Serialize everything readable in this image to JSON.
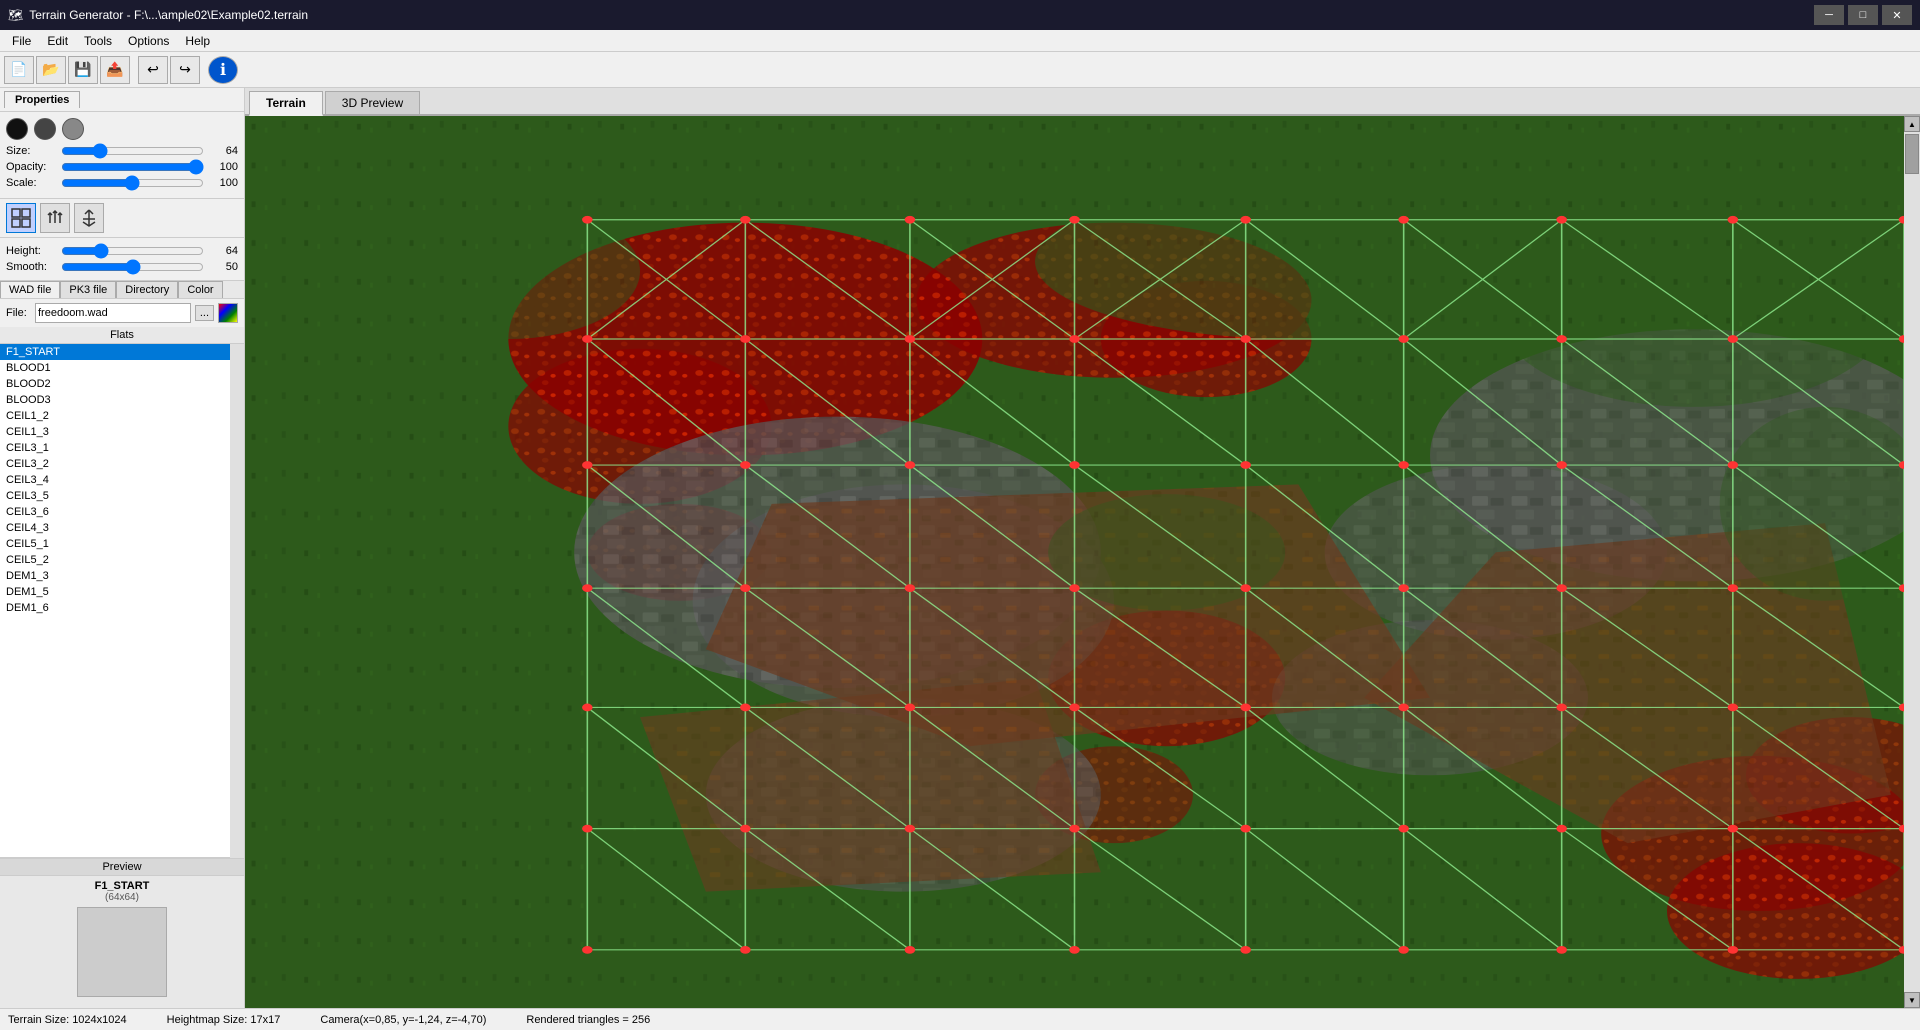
{
  "window": {
    "title": "Terrain Generator - F:\\...\\ample02\\Example02.terrain",
    "icon": "🗺"
  },
  "titlebar": {
    "minimize": "─",
    "maximize": "□",
    "close": "✕"
  },
  "menu": {
    "items": [
      "File",
      "Edit",
      "Tools",
      "Options",
      "Help"
    ]
  },
  "toolbar": {
    "buttons": [
      {
        "name": "new",
        "icon": "📄"
      },
      {
        "name": "open",
        "icon": "📂"
      },
      {
        "name": "save",
        "icon": "💾"
      },
      {
        "name": "export",
        "icon": "📤"
      },
      {
        "name": "undo",
        "icon": "↩"
      },
      {
        "name": "redo",
        "icon": "↪"
      },
      {
        "name": "info",
        "icon": "ℹ"
      }
    ]
  },
  "left_panel": {
    "properties_tab": "Properties",
    "brush": {
      "size_label": "Size:",
      "size_value": "64",
      "opacity_label": "Opacity:",
      "opacity_value": "100",
      "scale_label": "Scale:",
      "scale_value": "100"
    },
    "height": {
      "height_label": "Height:",
      "height_value": "64",
      "smooth_label": "Smooth:",
      "smooth_value": "50"
    },
    "texture_tabs": [
      "WAD file",
      "PK3 file",
      "Directory",
      "Color"
    ],
    "file": {
      "label": "File:",
      "value": "freedoom.wad",
      "browse": "...",
      "color": "🎨"
    },
    "flats_label": "Flats",
    "flats": [
      "F1_START",
      "BLOOD1",
      "BLOOD2",
      "BLOOD3",
      "CEIL1_2",
      "CEIL1_3",
      "CEIL3_1",
      "CEIL3_2",
      "CEIL3_4",
      "CEIL3_5",
      "CEIL3_6",
      "CEIL4_3",
      "CEIL5_1",
      "CEIL5_2",
      "DEM1_3",
      "DEM1_5",
      "DEM1_6"
    ],
    "preview_label": "Preview",
    "preview_name": "F1_START",
    "preview_size": "(64x64)"
  },
  "content": {
    "tabs": [
      "Terrain",
      "3D Preview"
    ],
    "active_tab": "Terrain"
  },
  "status": {
    "terrain_size": "Terrain Size: 1024x1024",
    "heightmap_size": "Heightmap Size: 17x17",
    "camera": "Camera(x=0,85, y=-1,24, z=-4,70)",
    "triangles": "Rendered triangles = 256"
  },
  "colors": {
    "grid_line": "#90ee90",
    "vertex_dot": "#ff4444",
    "grass": "#2d5a1b",
    "lava": "#cc2200",
    "rock": "#555555",
    "dirt": "#8B4513"
  }
}
